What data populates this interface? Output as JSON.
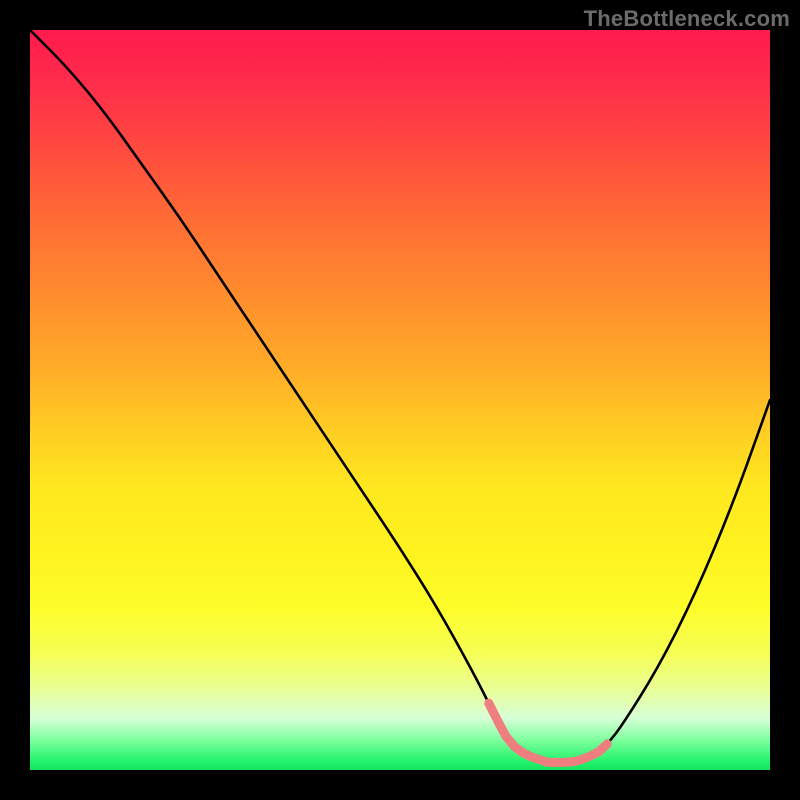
{
  "watermark": "TheBottleneck.com",
  "chart_data": {
    "type": "line",
    "title": "",
    "xlabel": "",
    "ylabel": "",
    "xlim": [
      0,
      100
    ],
    "ylim": [
      0,
      100
    ],
    "x": [
      0,
      5,
      10,
      15,
      20,
      25,
      30,
      35,
      40,
      45,
      50,
      55,
      60,
      63,
      64,
      65,
      67,
      70,
      73,
      75,
      77,
      78,
      80,
      85,
      90,
      95,
      100
    ],
    "values": [
      100,
      95,
      89,
      82,
      75,
      67.5,
      60,
      52.5,
      45,
      37.5,
      30,
      22,
      13,
      7,
      5,
      3.5,
      2,
      1,
      1,
      1.5,
      2.5,
      3.5,
      6,
      14,
      24,
      36,
      50
    ],
    "annotation_band": {
      "description": "pink marker band near minimum",
      "x_range": [
        62,
        78
      ],
      "y_approx": 2,
      "color": "#f08080"
    },
    "gradient_stops_percent_to_color": [
      [
        0,
        "#ff1a4d"
      ],
      [
        25,
        "#ff6a35"
      ],
      [
        50,
        "#ffc024"
      ],
      [
        75,
        "#fbfd25"
      ],
      [
        93,
        "#d7ffd7"
      ],
      [
        100,
        "#16e45f"
      ]
    ]
  }
}
